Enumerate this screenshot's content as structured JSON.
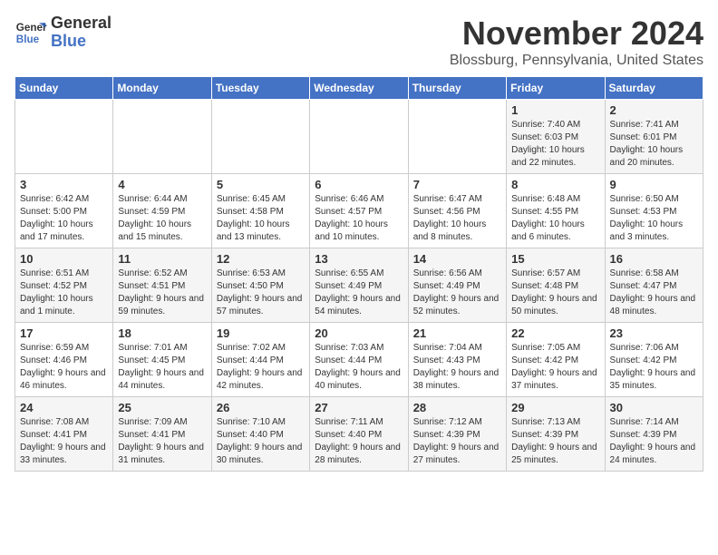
{
  "header": {
    "logo_line1": "General",
    "logo_line2": "Blue",
    "month": "November 2024",
    "location": "Blossburg, Pennsylvania, United States"
  },
  "weekdays": [
    "Sunday",
    "Monday",
    "Tuesday",
    "Wednesday",
    "Thursday",
    "Friday",
    "Saturday"
  ],
  "weeks": [
    [
      {
        "day": "",
        "info": ""
      },
      {
        "day": "",
        "info": ""
      },
      {
        "day": "",
        "info": ""
      },
      {
        "day": "",
        "info": ""
      },
      {
        "day": "",
        "info": ""
      },
      {
        "day": "1",
        "info": "Sunrise: 7:40 AM\nSunset: 6:03 PM\nDaylight: 10 hours and 22 minutes."
      },
      {
        "day": "2",
        "info": "Sunrise: 7:41 AM\nSunset: 6:01 PM\nDaylight: 10 hours and 20 minutes."
      }
    ],
    [
      {
        "day": "3",
        "info": "Sunrise: 6:42 AM\nSunset: 5:00 PM\nDaylight: 10 hours and 17 minutes."
      },
      {
        "day": "4",
        "info": "Sunrise: 6:44 AM\nSunset: 4:59 PM\nDaylight: 10 hours and 15 minutes."
      },
      {
        "day": "5",
        "info": "Sunrise: 6:45 AM\nSunset: 4:58 PM\nDaylight: 10 hours and 13 minutes."
      },
      {
        "day": "6",
        "info": "Sunrise: 6:46 AM\nSunset: 4:57 PM\nDaylight: 10 hours and 10 minutes."
      },
      {
        "day": "7",
        "info": "Sunrise: 6:47 AM\nSunset: 4:56 PM\nDaylight: 10 hours and 8 minutes."
      },
      {
        "day": "8",
        "info": "Sunrise: 6:48 AM\nSunset: 4:55 PM\nDaylight: 10 hours and 6 minutes."
      },
      {
        "day": "9",
        "info": "Sunrise: 6:50 AM\nSunset: 4:53 PM\nDaylight: 10 hours and 3 minutes."
      }
    ],
    [
      {
        "day": "10",
        "info": "Sunrise: 6:51 AM\nSunset: 4:52 PM\nDaylight: 10 hours and 1 minute."
      },
      {
        "day": "11",
        "info": "Sunrise: 6:52 AM\nSunset: 4:51 PM\nDaylight: 9 hours and 59 minutes."
      },
      {
        "day": "12",
        "info": "Sunrise: 6:53 AM\nSunset: 4:50 PM\nDaylight: 9 hours and 57 minutes."
      },
      {
        "day": "13",
        "info": "Sunrise: 6:55 AM\nSunset: 4:49 PM\nDaylight: 9 hours and 54 minutes."
      },
      {
        "day": "14",
        "info": "Sunrise: 6:56 AM\nSunset: 4:49 PM\nDaylight: 9 hours and 52 minutes."
      },
      {
        "day": "15",
        "info": "Sunrise: 6:57 AM\nSunset: 4:48 PM\nDaylight: 9 hours and 50 minutes."
      },
      {
        "day": "16",
        "info": "Sunrise: 6:58 AM\nSunset: 4:47 PM\nDaylight: 9 hours and 48 minutes."
      }
    ],
    [
      {
        "day": "17",
        "info": "Sunrise: 6:59 AM\nSunset: 4:46 PM\nDaylight: 9 hours and 46 minutes."
      },
      {
        "day": "18",
        "info": "Sunrise: 7:01 AM\nSunset: 4:45 PM\nDaylight: 9 hours and 44 minutes."
      },
      {
        "day": "19",
        "info": "Sunrise: 7:02 AM\nSunset: 4:44 PM\nDaylight: 9 hours and 42 minutes."
      },
      {
        "day": "20",
        "info": "Sunrise: 7:03 AM\nSunset: 4:44 PM\nDaylight: 9 hours and 40 minutes."
      },
      {
        "day": "21",
        "info": "Sunrise: 7:04 AM\nSunset: 4:43 PM\nDaylight: 9 hours and 38 minutes."
      },
      {
        "day": "22",
        "info": "Sunrise: 7:05 AM\nSunset: 4:42 PM\nDaylight: 9 hours and 37 minutes."
      },
      {
        "day": "23",
        "info": "Sunrise: 7:06 AM\nSunset: 4:42 PM\nDaylight: 9 hours and 35 minutes."
      }
    ],
    [
      {
        "day": "24",
        "info": "Sunrise: 7:08 AM\nSunset: 4:41 PM\nDaylight: 9 hours and 33 minutes."
      },
      {
        "day": "25",
        "info": "Sunrise: 7:09 AM\nSunset: 4:41 PM\nDaylight: 9 hours and 31 minutes."
      },
      {
        "day": "26",
        "info": "Sunrise: 7:10 AM\nSunset: 4:40 PM\nDaylight: 9 hours and 30 minutes."
      },
      {
        "day": "27",
        "info": "Sunrise: 7:11 AM\nSunset: 4:40 PM\nDaylight: 9 hours and 28 minutes."
      },
      {
        "day": "28",
        "info": "Sunrise: 7:12 AM\nSunset: 4:39 PM\nDaylight: 9 hours and 27 minutes."
      },
      {
        "day": "29",
        "info": "Sunrise: 7:13 AM\nSunset: 4:39 PM\nDaylight: 9 hours and 25 minutes."
      },
      {
        "day": "30",
        "info": "Sunrise: 7:14 AM\nSunset: 4:39 PM\nDaylight: 9 hours and 24 minutes."
      }
    ]
  ]
}
